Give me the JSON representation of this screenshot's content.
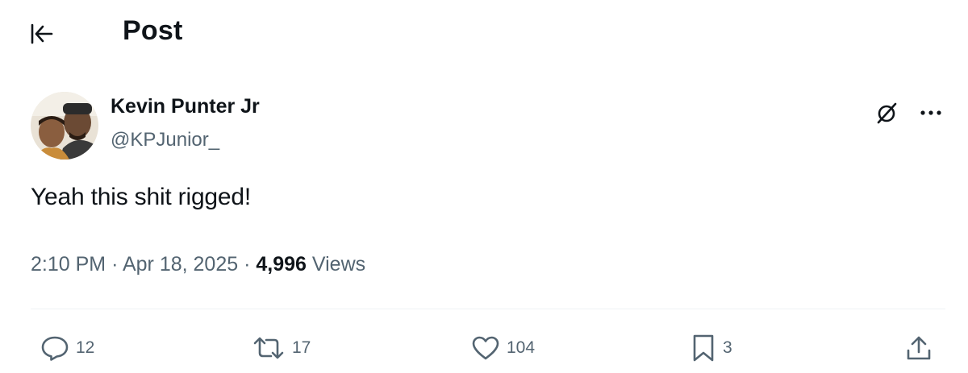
{
  "header": {
    "back_icon": "arrow-left-icon",
    "title": "Post"
  },
  "author": {
    "display_name": "Kevin Punter Jr",
    "handle": "@KPJunior_",
    "avatar_icon": "avatar-photo"
  },
  "tweet": {
    "text": "Yeah this shit rigged!",
    "time": "2:10 PM",
    "sep1": "·",
    "date": "Apr 18, 2025",
    "sep2": "·",
    "views_count": "4,996",
    "views_label": "Views"
  },
  "top_actions": {
    "grok_icon": "grok-icon",
    "more_icon": "more-horizontal-icon"
  },
  "actions": {
    "reply": {
      "icon": "reply-icon",
      "count": "12"
    },
    "repost": {
      "icon": "repost-icon",
      "count": "17"
    },
    "like": {
      "icon": "heart-icon",
      "count": "104"
    },
    "bookmark": {
      "icon": "bookmark-icon",
      "count": "3"
    },
    "share": {
      "icon": "share-icon"
    }
  },
  "colors": {
    "text_primary": "#0f1419",
    "text_secondary": "#536471",
    "divider": "#eff3f4",
    "background": "#ffffff"
  }
}
